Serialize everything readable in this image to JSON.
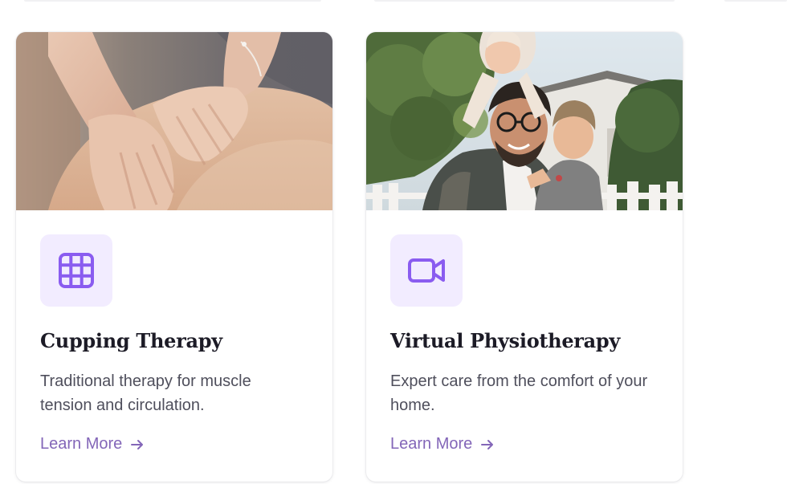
{
  "accent_color": "#8a5cf0",
  "tile_color": "#f2ecff",
  "link_color": "#8366b8",
  "cards": [
    {
      "title": "Cupping Therapy",
      "description": "Traditional therapy for muscle tension and circulation.",
      "link_label": "Learn More",
      "icon": "grid-icon",
      "photo": "massage-photo"
    },
    {
      "title": "Virtual Physiotherapy",
      "description": "Expert care from the comfort of your home.",
      "link_label": "Learn More",
      "icon": "video-camera-icon",
      "photo": "family-photo"
    }
  ]
}
